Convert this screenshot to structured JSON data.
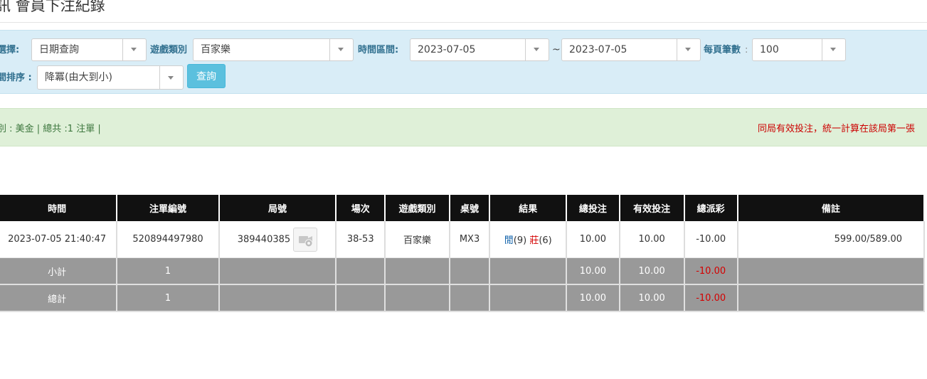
{
  "page": {
    "title": "訊 會員下注紀錄"
  },
  "filters": {
    "select_label": "選擇:",
    "select_value": "日期查詢",
    "game_type_label": "遊戲類別",
    "game_type_value": "百家樂",
    "time_range_label": "時間區間:",
    "date_from": "2023-07-05",
    "range_separator": "~",
    "date_to": "2023-07-05",
    "per_page_label": "每頁筆數",
    "per_page_colon": ":",
    "per_page_value": "100",
    "sort_label": "間排序 :",
    "sort_value": "降冪(由大到小)",
    "query_button": "查詢"
  },
  "summary": {
    "text": "別 : 美金 | 總共 :1 注單 |",
    "note": "同局有效投注，統一計算在該局第一張"
  },
  "table": {
    "columns": [
      "時間",
      "注單編號",
      "局號",
      "場次",
      "遊戲類別",
      "桌號",
      "結果",
      "總投注",
      "有效投注",
      "總派彩",
      "備註"
    ],
    "row": {
      "time": "2023-07-05 21:40:47",
      "bet_id": "520894497980",
      "round_id": "389440385",
      "session": "38-53",
      "game_type": "百家樂",
      "table_no": "MX3",
      "result_player": "閒",
      "result_player_pts": "(9)",
      "result_banker": "莊",
      "result_banker_pts": "(6)",
      "total_bet": "10.00",
      "valid_bet": "10.00",
      "payout": "-10.00",
      "remark": "599.00/589.00"
    },
    "subtotal": {
      "label": "小計",
      "count": "1",
      "total_bet": "10.00",
      "valid_bet": "10.00",
      "payout": "-10.00"
    },
    "grandtotal": {
      "label": "總計",
      "count": "1",
      "total_bet": "10.00",
      "valid_bet": "10.00",
      "payout": "-10.00"
    }
  },
  "colors": {
    "filter_bg": "#d9edf7",
    "label_color": "#31708f",
    "summary_bg": "#dff0d8",
    "note_color": "#cc0000",
    "header_bg": "#111111",
    "total_row_bg": "#999999",
    "button_bg": "#5bc0de"
  },
  "icons": [
    "chevron-down-icon",
    "video-replay-icon"
  ]
}
